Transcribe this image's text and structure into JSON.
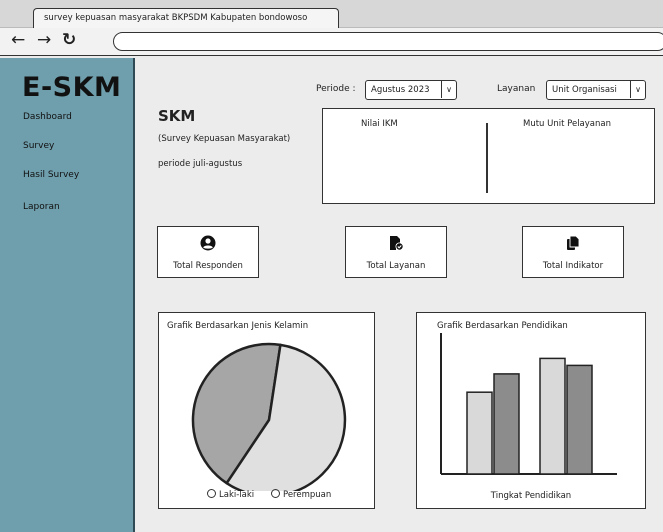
{
  "browser": {
    "tab_title": "survey kepuasan masyarakat BKPSDM Kabupaten bondowoso",
    "back_icon": "←",
    "forward_icon": "→",
    "reload_icon": "↻",
    "url": ""
  },
  "sidebar": {
    "brand": "E-SKM",
    "items": [
      {
        "label": "Dashboard"
      },
      {
        "label": "Survey"
      },
      {
        "label": "Hasil Survey"
      },
      {
        "label": "Laporan"
      }
    ]
  },
  "filters": {
    "periode_label": "Periode :",
    "periode_value": "Agustus 2023",
    "layanan_label": "Layanan",
    "layanan_value": "Unit Organisasi",
    "dropdown_icon": "∨"
  },
  "header": {
    "title": "SKM",
    "subtitle": "(Survey Kepuasan Masyarakat)",
    "period": "periode juli-agustus"
  },
  "ikm": {
    "nilai_label": "Nilai IKM",
    "mutu_label": "Mutu Unit Pelayanan"
  },
  "cards": [
    {
      "label": "Total Responden",
      "icon": "user-circle-icon"
    },
    {
      "label": "Total Layanan",
      "icon": "document-check-icon"
    },
    {
      "label": "Total Indikator",
      "icon": "copy-document-icon"
    }
  ],
  "colors": {
    "sidebar": "#6f9eac",
    "pie_laki": "#a6a6a6",
    "pie_perempuan": "#e0e0e0",
    "bar_light": "#d9d9d9",
    "bar_dark": "#8c8c8c"
  },
  "chart_data": [
    {
      "type": "pie",
      "title": "Grafik Berdasarkan Jenis Kelamin",
      "labels": [
        "Laki-laki",
        "Perempuan"
      ],
      "values": [
        43,
        57
      ],
      "legend": "bottom"
    },
    {
      "type": "bar",
      "title": "Grafik Berdasarkan Pendidikan",
      "xlabel": "Tingkat Pendidikan",
      "ylabel": "",
      "categories": [
        "",
        ""
      ],
      "series": [
        {
          "values": [
            58,
            82
          ]
        },
        {
          "values": [
            71,
            77
          ]
        }
      ],
      "ylim": [
        0,
        100
      ],
      "grid": false,
      "legend": "none"
    }
  ]
}
